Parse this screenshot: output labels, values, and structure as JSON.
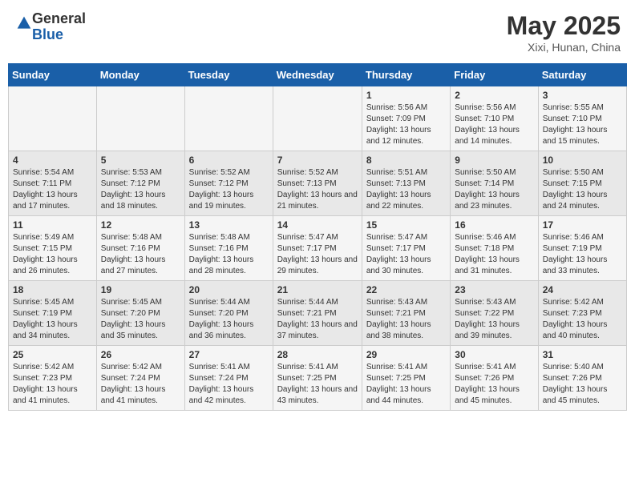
{
  "header": {
    "logo_general": "General",
    "logo_blue": "Blue",
    "month_title": "May 2025",
    "location": "Xixi, Hunan, China"
  },
  "days_of_week": [
    "Sunday",
    "Monday",
    "Tuesday",
    "Wednesday",
    "Thursday",
    "Friday",
    "Saturday"
  ],
  "weeks": [
    {
      "cells": [
        {
          "day": "",
          "info": ""
        },
        {
          "day": "",
          "info": ""
        },
        {
          "day": "",
          "info": ""
        },
        {
          "day": "",
          "info": ""
        },
        {
          "day": "1",
          "sunrise": "Sunrise: 5:56 AM",
          "sunset": "Sunset: 7:09 PM",
          "daylight": "Daylight: 13 hours and 12 minutes."
        },
        {
          "day": "2",
          "sunrise": "Sunrise: 5:56 AM",
          "sunset": "Sunset: 7:10 PM",
          "daylight": "Daylight: 13 hours and 14 minutes."
        },
        {
          "day": "3",
          "sunrise": "Sunrise: 5:55 AM",
          "sunset": "Sunset: 7:10 PM",
          "daylight": "Daylight: 13 hours and 15 minutes."
        }
      ]
    },
    {
      "cells": [
        {
          "day": "4",
          "sunrise": "Sunrise: 5:54 AM",
          "sunset": "Sunset: 7:11 PM",
          "daylight": "Daylight: 13 hours and 17 minutes."
        },
        {
          "day": "5",
          "sunrise": "Sunrise: 5:53 AM",
          "sunset": "Sunset: 7:12 PM",
          "daylight": "Daylight: 13 hours and 18 minutes."
        },
        {
          "day": "6",
          "sunrise": "Sunrise: 5:52 AM",
          "sunset": "Sunset: 7:12 PM",
          "daylight": "Daylight: 13 hours and 19 minutes."
        },
        {
          "day": "7",
          "sunrise": "Sunrise: 5:52 AM",
          "sunset": "Sunset: 7:13 PM",
          "daylight": "Daylight: 13 hours and 21 minutes."
        },
        {
          "day": "8",
          "sunrise": "Sunrise: 5:51 AM",
          "sunset": "Sunset: 7:13 PM",
          "daylight": "Daylight: 13 hours and 22 minutes."
        },
        {
          "day": "9",
          "sunrise": "Sunrise: 5:50 AM",
          "sunset": "Sunset: 7:14 PM",
          "daylight": "Daylight: 13 hours and 23 minutes."
        },
        {
          "day": "10",
          "sunrise": "Sunrise: 5:50 AM",
          "sunset": "Sunset: 7:15 PM",
          "daylight": "Daylight: 13 hours and 24 minutes."
        }
      ]
    },
    {
      "cells": [
        {
          "day": "11",
          "sunrise": "Sunrise: 5:49 AM",
          "sunset": "Sunset: 7:15 PM",
          "daylight": "Daylight: 13 hours and 26 minutes."
        },
        {
          "day": "12",
          "sunrise": "Sunrise: 5:48 AM",
          "sunset": "Sunset: 7:16 PM",
          "daylight": "Daylight: 13 hours and 27 minutes."
        },
        {
          "day": "13",
          "sunrise": "Sunrise: 5:48 AM",
          "sunset": "Sunset: 7:16 PM",
          "daylight": "Daylight: 13 hours and 28 minutes."
        },
        {
          "day": "14",
          "sunrise": "Sunrise: 5:47 AM",
          "sunset": "Sunset: 7:17 PM",
          "daylight": "Daylight: 13 hours and 29 minutes."
        },
        {
          "day": "15",
          "sunrise": "Sunrise: 5:47 AM",
          "sunset": "Sunset: 7:17 PM",
          "daylight": "Daylight: 13 hours and 30 minutes."
        },
        {
          "day": "16",
          "sunrise": "Sunrise: 5:46 AM",
          "sunset": "Sunset: 7:18 PM",
          "daylight": "Daylight: 13 hours and 31 minutes."
        },
        {
          "day": "17",
          "sunrise": "Sunrise: 5:46 AM",
          "sunset": "Sunset: 7:19 PM",
          "daylight": "Daylight: 13 hours and 33 minutes."
        }
      ]
    },
    {
      "cells": [
        {
          "day": "18",
          "sunrise": "Sunrise: 5:45 AM",
          "sunset": "Sunset: 7:19 PM",
          "daylight": "Daylight: 13 hours and 34 minutes."
        },
        {
          "day": "19",
          "sunrise": "Sunrise: 5:45 AM",
          "sunset": "Sunset: 7:20 PM",
          "daylight": "Daylight: 13 hours and 35 minutes."
        },
        {
          "day": "20",
          "sunrise": "Sunrise: 5:44 AM",
          "sunset": "Sunset: 7:20 PM",
          "daylight": "Daylight: 13 hours and 36 minutes."
        },
        {
          "day": "21",
          "sunrise": "Sunrise: 5:44 AM",
          "sunset": "Sunset: 7:21 PM",
          "daylight": "Daylight: 13 hours and 37 minutes."
        },
        {
          "day": "22",
          "sunrise": "Sunrise: 5:43 AM",
          "sunset": "Sunset: 7:21 PM",
          "daylight": "Daylight: 13 hours and 38 minutes."
        },
        {
          "day": "23",
          "sunrise": "Sunrise: 5:43 AM",
          "sunset": "Sunset: 7:22 PM",
          "daylight": "Daylight: 13 hours and 39 minutes."
        },
        {
          "day": "24",
          "sunrise": "Sunrise: 5:42 AM",
          "sunset": "Sunset: 7:23 PM",
          "daylight": "Daylight: 13 hours and 40 minutes."
        }
      ]
    },
    {
      "cells": [
        {
          "day": "25",
          "sunrise": "Sunrise: 5:42 AM",
          "sunset": "Sunset: 7:23 PM",
          "daylight": "Daylight: 13 hours and 41 minutes."
        },
        {
          "day": "26",
          "sunrise": "Sunrise: 5:42 AM",
          "sunset": "Sunset: 7:24 PM",
          "daylight": "Daylight: 13 hours and 41 minutes."
        },
        {
          "day": "27",
          "sunrise": "Sunrise: 5:41 AM",
          "sunset": "Sunset: 7:24 PM",
          "daylight": "Daylight: 13 hours and 42 minutes."
        },
        {
          "day": "28",
          "sunrise": "Sunrise: 5:41 AM",
          "sunset": "Sunset: 7:25 PM",
          "daylight": "Daylight: 13 hours and 43 minutes."
        },
        {
          "day": "29",
          "sunrise": "Sunrise: 5:41 AM",
          "sunset": "Sunset: 7:25 PM",
          "daylight": "Daylight: 13 hours and 44 minutes."
        },
        {
          "day": "30",
          "sunrise": "Sunrise: 5:41 AM",
          "sunset": "Sunset: 7:26 PM",
          "daylight": "Daylight: 13 hours and 45 minutes."
        },
        {
          "day": "31",
          "sunrise": "Sunrise: 5:40 AM",
          "sunset": "Sunset: 7:26 PM",
          "daylight": "Daylight: 13 hours and 45 minutes."
        }
      ]
    }
  ]
}
